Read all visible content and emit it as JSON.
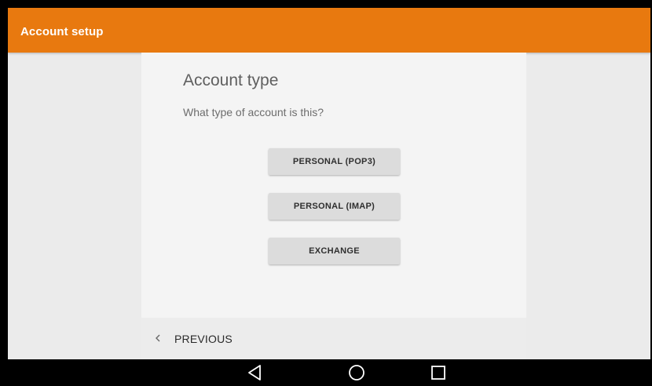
{
  "appbar": {
    "title": "Account setup",
    "color": "#e8790f"
  },
  "main": {
    "title": "Account type",
    "subtitle": "What type of account is this?",
    "options": [
      {
        "label": "PERSONAL (POP3)"
      },
      {
        "label": "PERSONAL (IMAP)"
      },
      {
        "label": "EXCHANGE"
      }
    ]
  },
  "footer": {
    "previous_label": "PREVIOUS",
    "previous_icon": "chevron-left-icon"
  },
  "navbar": {
    "icons": [
      "back-icon",
      "home-icon",
      "recents-icon"
    ]
  }
}
